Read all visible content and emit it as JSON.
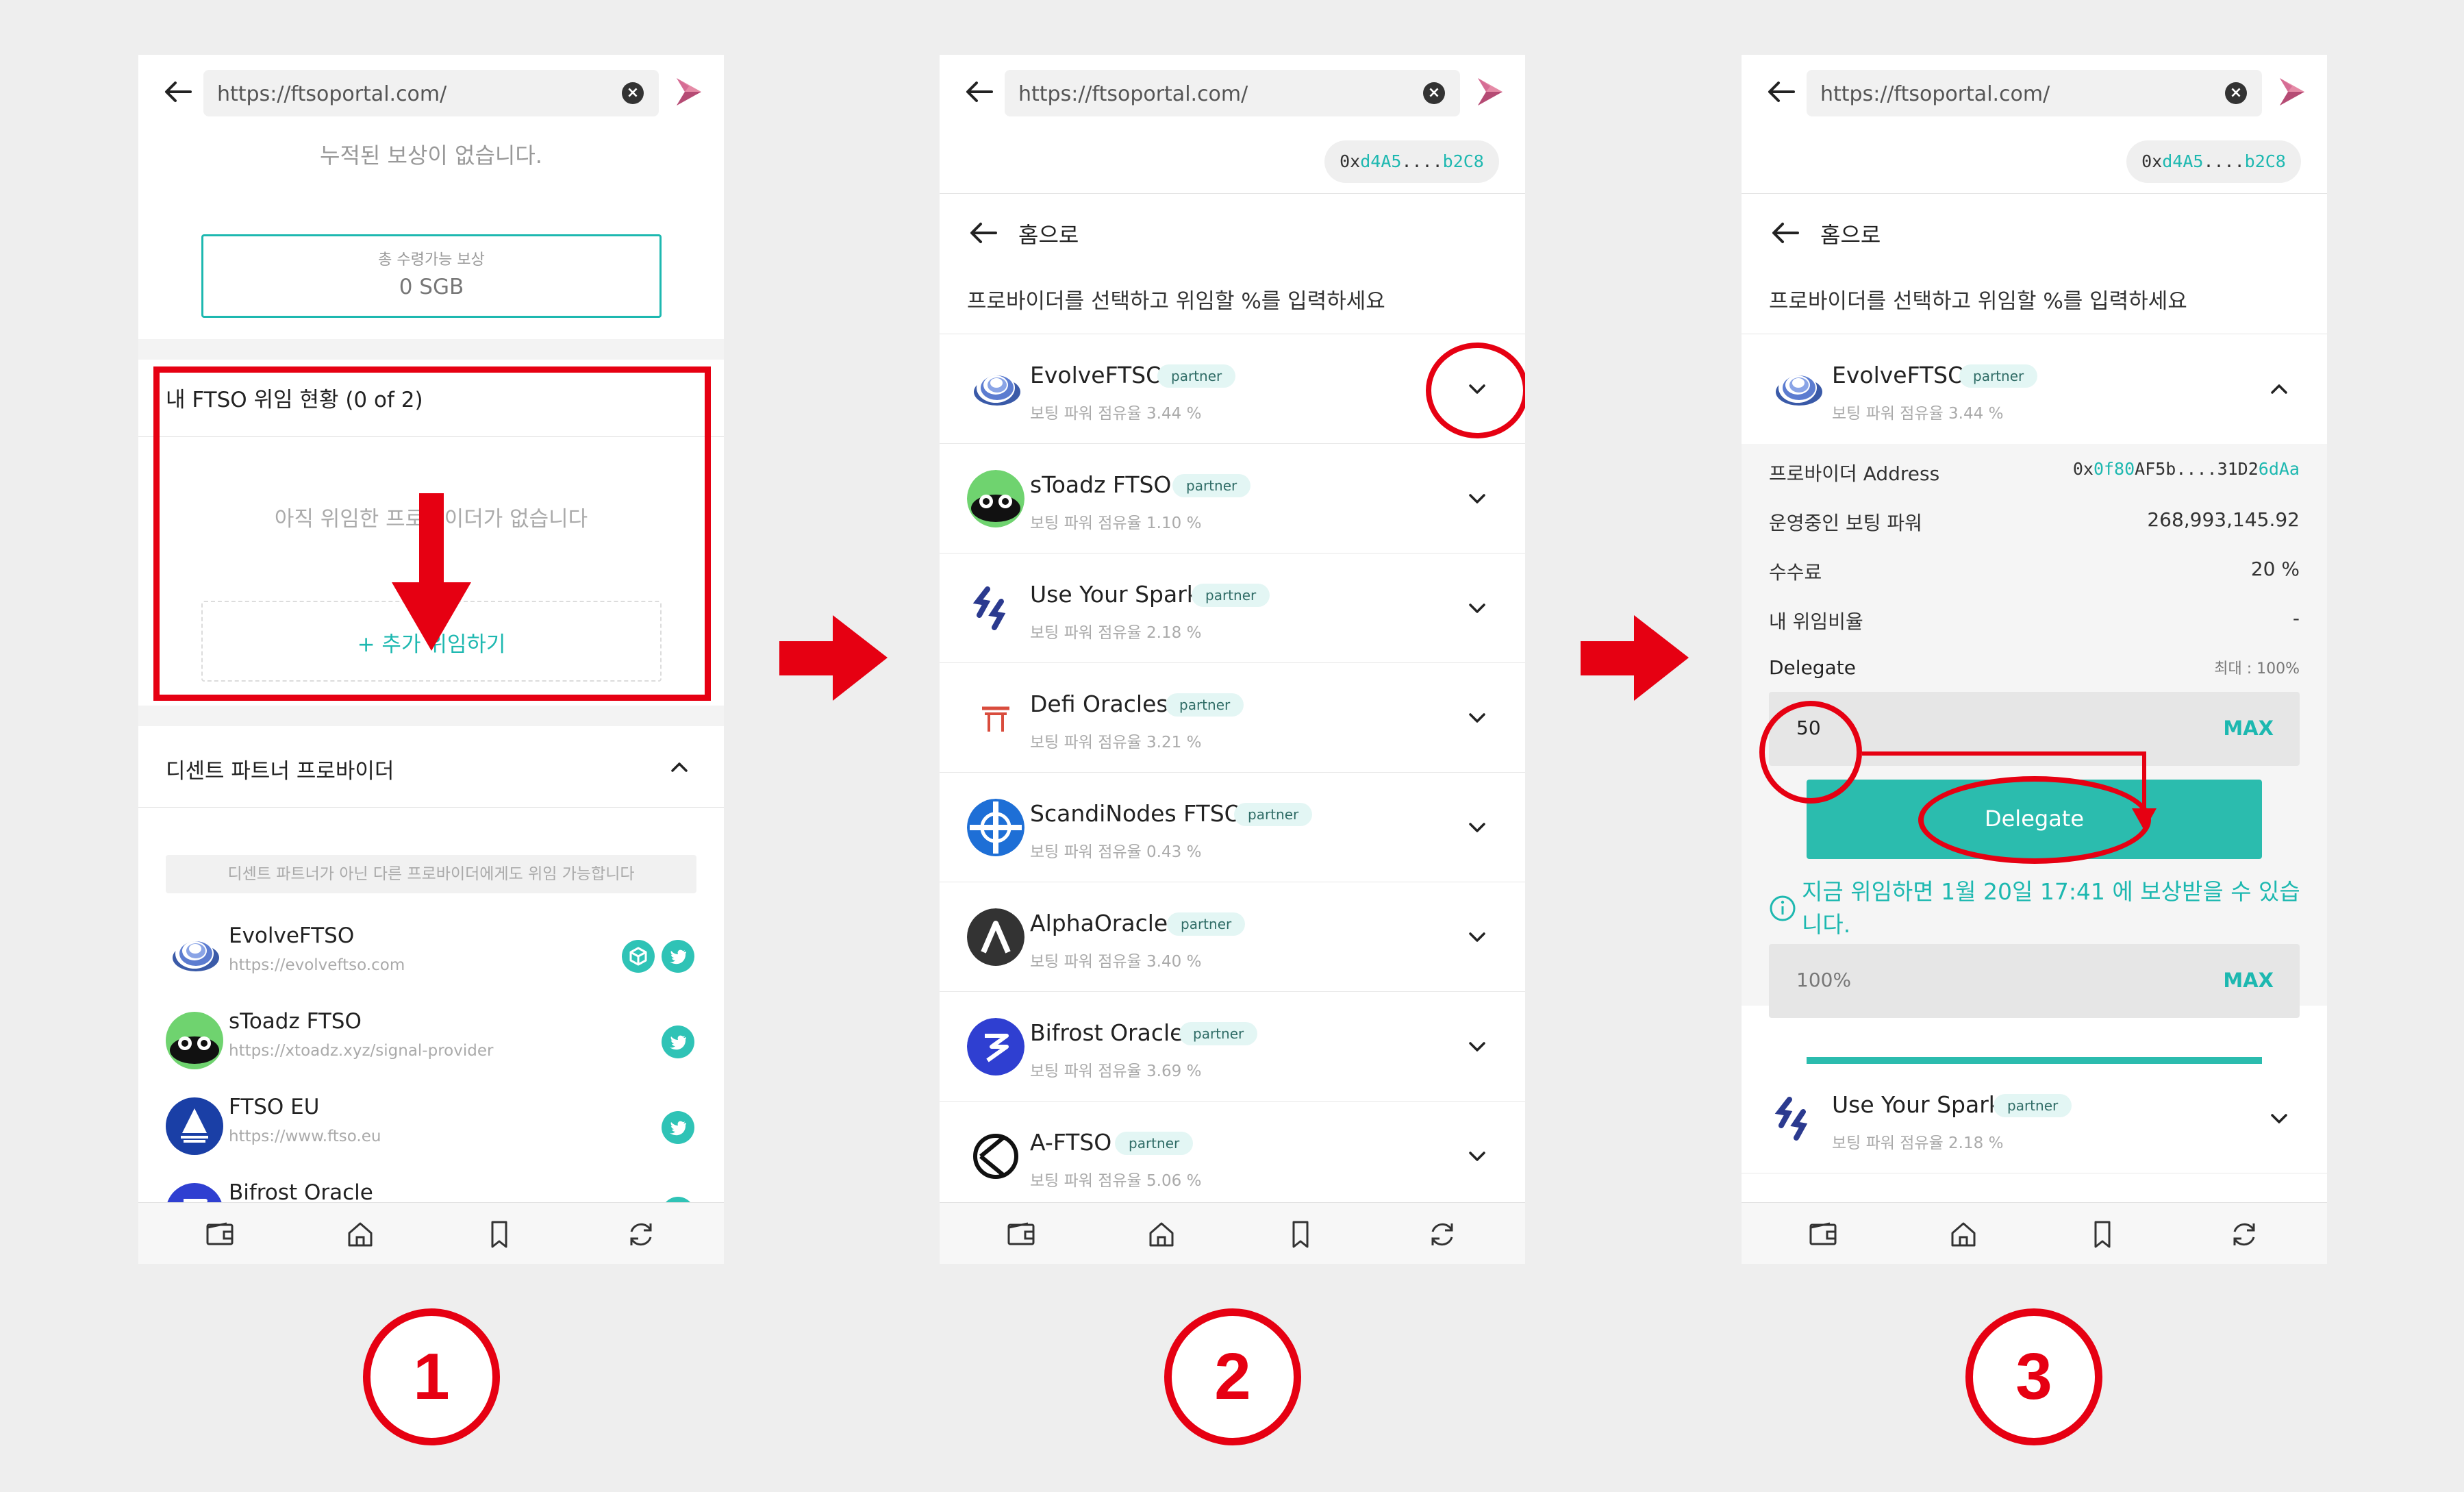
{
  "colors": {
    "accent": "#1db8b0",
    "annotation_red": "#e60012",
    "background": "#eeeeee"
  },
  "browser": {
    "url": "https://ftsoportal.com/"
  },
  "wallet_address": {
    "prefix": "0x",
    "part1": "d4A5",
    "ellipsis": "....",
    "part2": "b2C8"
  },
  "step_numbers": [
    "1",
    "2",
    "3"
  ],
  "screen1": {
    "no_rewards_text": "누적된 보상이 없습니다.",
    "total_rewards_label": "총 수령가능 보상",
    "total_rewards_value": "0 SGB",
    "delegation_status_title": "내 FTSO 위임 현황 (0 of 2)",
    "no_delegation_text": "아직 위임한 프로바이더가 없습니다",
    "add_delegation_button": "+ 추가 위임하기",
    "partner_section_title": "디센트 파트너 프로바이더",
    "partner_notice": "디센트 파트너가 아닌 다른 프로바이더에게도 위임 가능합니다",
    "partners": [
      {
        "name": "EvolveFTSO",
        "url": "https://evolveftso.com",
        "icon": "evolve-logo",
        "links": [
          "web-icon",
          "twitter-icon"
        ]
      },
      {
        "name": "sToadz FTSO",
        "url": "https://xtoadz.xyz/signal-provider",
        "icon": "stoadz-logo",
        "links": [
          "twitter-icon"
        ]
      },
      {
        "name": "FTSO EU",
        "url": "https://www.ftso.eu",
        "icon": "ftso-eu-logo",
        "links": [
          "twitter-icon"
        ]
      },
      {
        "name": "Bifrost Oracle",
        "url": "",
        "icon": "bifrost-logo",
        "links": [
          "twitter-icon"
        ]
      }
    ]
  },
  "screen2": {
    "back_home": "홈으로",
    "instruction": "프로바이더를 선택하고 위임할 %를 입력하세요",
    "badge": "partner",
    "providers": [
      {
        "name": "EvolveFTSO",
        "sub": "보팅 파워 점유율 3.44 %"
      },
      {
        "name": "sToadz FTSO",
        "sub": "보팅 파워 점유율 1.10 %"
      },
      {
        "name": "Use Your Spark",
        "sub": "보팅 파워 점유율 2.18 %"
      },
      {
        "name": "Defi Oracles",
        "sub": "보팅 파워 점유율 3.21 %"
      },
      {
        "name": "ScandiNodes FTSO",
        "sub": "보팅 파워 점유율 0.43 %"
      },
      {
        "name": "AlphaOracle",
        "sub": "보팅 파워 점유율 3.40 %"
      },
      {
        "name": "Bifrost Oracle",
        "sub": "보팅 파워 점유율 3.69 %"
      },
      {
        "name": "A-FTSO",
        "sub": "보팅 파워 점유율 5.06 %"
      }
    ]
  },
  "screen3": {
    "back_home": "홈으로",
    "instruction": "프로바이더를 선택하고 위임할 %를 입력하세요",
    "badge": "partner",
    "provider_name": "EvolveFTSO",
    "provider_sub": "보팅 파워 점유율 3.44 %",
    "details": [
      {
        "label": "프로바이더 Address",
        "value_prefix": "0x",
        "value_hl1": "0f80",
        "value_mid": "AF5b....31D2",
        "value_hl2": "6dAa"
      },
      {
        "label": "운영중인 보팅 파워",
        "value": "268,993,145.92"
      },
      {
        "label": "수수료",
        "value": "20 %"
      },
      {
        "label": "내 위임비율",
        "value": "-"
      }
    ],
    "delegate_label": "Delegate",
    "max_hint": "최대 : 100%",
    "input_value": "50",
    "max_button": "MAX",
    "delegate_button": "Delegate",
    "info_text_line1": "지금 위임하면 1월 20일 17:41 에 보상받을 수 있습",
    "info_text_line2": "니다.",
    "second_input_value": "100%",
    "second_max_button": "MAX",
    "next_provider_name": "Use Your Spark",
    "next_provider_sub": "보팅 파워 점유율 2.18 %"
  }
}
